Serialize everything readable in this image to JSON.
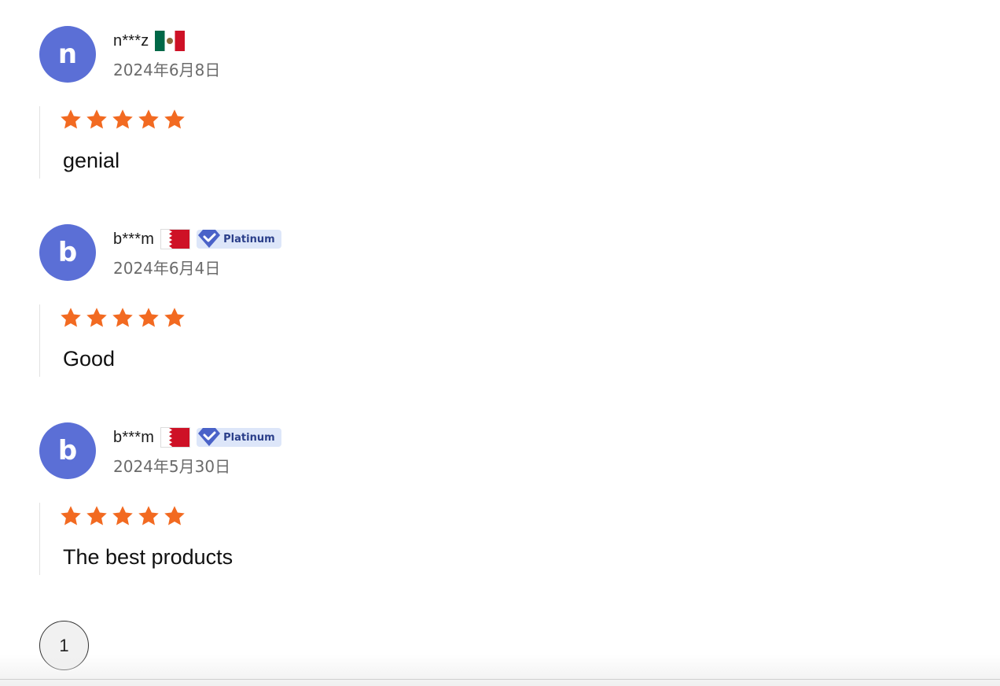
{
  "colors": {
    "avatar": "#5b6fd6",
    "star": "#f26a21",
    "badge_bg": "#dde6f9",
    "badge_text": "#2b3f8a",
    "date_text": "#6b6b6b"
  },
  "reviews": [
    {
      "initial": "n",
      "username": "n***z",
      "flag": "mexico-flag-icon",
      "badge": null,
      "date": "2024年6月8日",
      "rating": 5,
      "text": "genial"
    },
    {
      "initial": "b",
      "username": "b***m",
      "flag": "bahrain-flag-icon",
      "badge": "Platinum",
      "date": "2024年6月4日",
      "rating": 5,
      "text": "Good"
    },
    {
      "initial": "b",
      "username": "b***m",
      "flag": "bahrain-flag-icon",
      "badge": "Platinum",
      "date": "2024年5月30日",
      "rating": 5,
      "text": "The best products"
    }
  ],
  "pagination": {
    "current_page": "1"
  }
}
